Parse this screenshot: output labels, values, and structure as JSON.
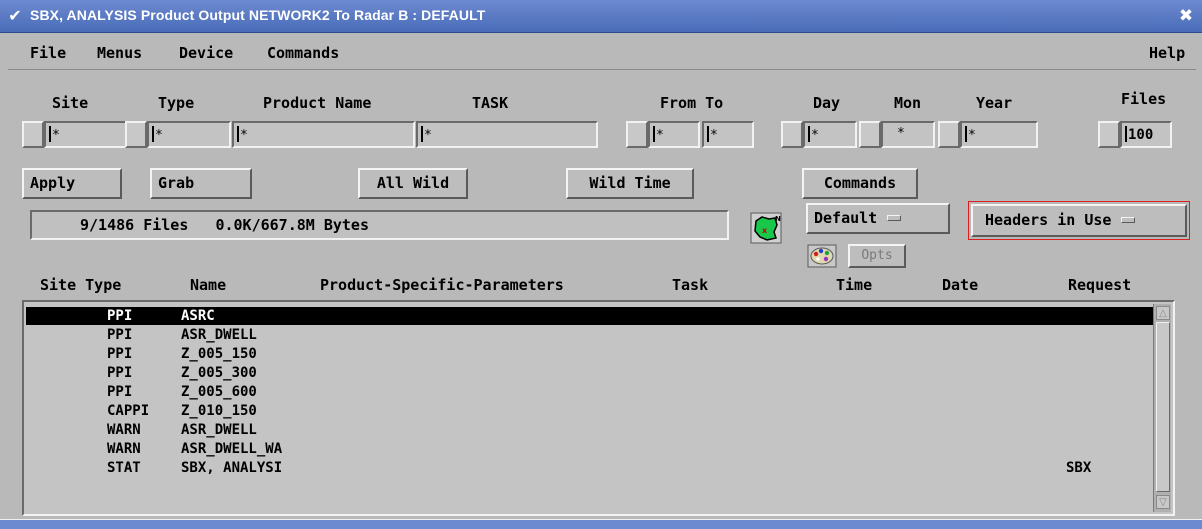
{
  "window": {
    "title": "SBX, ANALYSIS   Product Output NETWORK2 To Radar B : DEFAULT",
    "menu_icon": "chevron-down-icon",
    "close_icon": "close-icon"
  },
  "menubar": {
    "file": "File",
    "menus": "Menus",
    "device": "Device",
    "commands": "Commands",
    "help": "Help"
  },
  "filters": {
    "labels": {
      "site": "Site",
      "type": "Type",
      "product_name": "Product Name",
      "task": "TASK",
      "from_to": "From To",
      "day": "Day",
      "mon": "Mon",
      "year": "Year",
      "files": "Files"
    },
    "values": {
      "site": "*",
      "type": "*",
      "product_name": "*",
      "task": "*",
      "from": "*",
      "to": "*",
      "day": "*",
      "mon": "*",
      "year": "*",
      "files": "100"
    }
  },
  "buttons": {
    "apply": "Apply",
    "grab": "Grab",
    "all_wild": "All Wild",
    "wild_time": "Wild Time",
    "commands": "Commands",
    "default": "Default",
    "headers": "Headers in Use",
    "opts": "Opts"
  },
  "status": {
    "files": "9/1486 Files",
    "bytes": "0.0K/667.8M Bytes"
  },
  "columns": {
    "site_type": "Site Type",
    "name": "Name",
    "params": "Product-Specific-Parameters",
    "task": "Task",
    "time": "Time",
    "date": "Date",
    "request": "Request"
  },
  "rows": [
    {
      "type": "PPI",
      "name": "ASRC",
      "request": ""
    },
    {
      "type": "PPI",
      "name": "ASR_DWELL",
      "request": ""
    },
    {
      "type": "PPI",
      "name": "Z_005_150",
      "request": ""
    },
    {
      "type": "PPI",
      "name": "Z_005_300",
      "request": ""
    },
    {
      "type": "PPI",
      "name": "Z_005_600",
      "request": ""
    },
    {
      "type": "CAPPI",
      "name": "Z_010_150",
      "request": ""
    },
    {
      "type": "WARN",
      "name": "ASR_DWELL",
      "request": ""
    },
    {
      "type": "WARN",
      "name": "ASR_DWELL_WA",
      "request": ""
    },
    {
      "type": "STAT",
      "name": "SBX, ANALYSI",
      "request": "SBX"
    }
  ],
  "colors": {
    "titlebar": "#5878c4",
    "headers_border": "#d9201f",
    "map_icon_bg": "#19c84a"
  }
}
